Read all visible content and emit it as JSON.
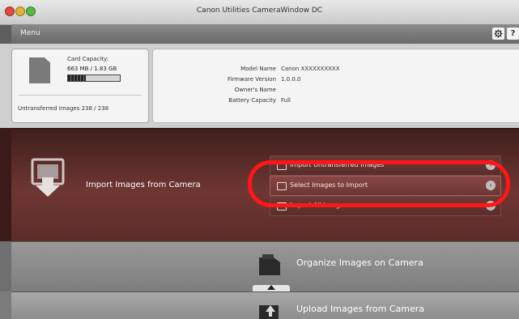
{
  "window": {
    "title": "Canon Utilities CameraWindow DC"
  },
  "menubar": {
    "menu_label": "Menu",
    "settings_icon": "gear-icon",
    "help_label": "?"
  },
  "card": {
    "capacity_label": "Card Capacity:",
    "capacity_value": "663 MB / 1.83 GB",
    "usage_fraction": 0.35,
    "untransferred_text": "Untransferred Images   238 / 238"
  },
  "camera": {
    "specs": [
      {
        "key": "Model Name",
        "value": "Canon XXXXXXXXXX"
      },
      {
        "key": "Firmware Version",
        "value": "1.0.0.0"
      },
      {
        "key": "Owner's Name",
        "value": ""
      },
      {
        "key": "Battery Capacity",
        "value": "Full"
      }
    ]
  },
  "import": {
    "label": "Import Images from Camera",
    "options": [
      {
        "label": "Import Untransferred Images",
        "icon": "import-untransferred-icon"
      },
      {
        "label": "Select Images to Import",
        "icon": "select-images-icon"
      },
      {
        "label": "Import All Images",
        "icon": "import-all-icon"
      }
    ],
    "highlight_color": "#ff1616"
  },
  "organize": {
    "label": "Organize Images on Camera"
  },
  "upload": {
    "label": "Upload Images from Camera"
  }
}
